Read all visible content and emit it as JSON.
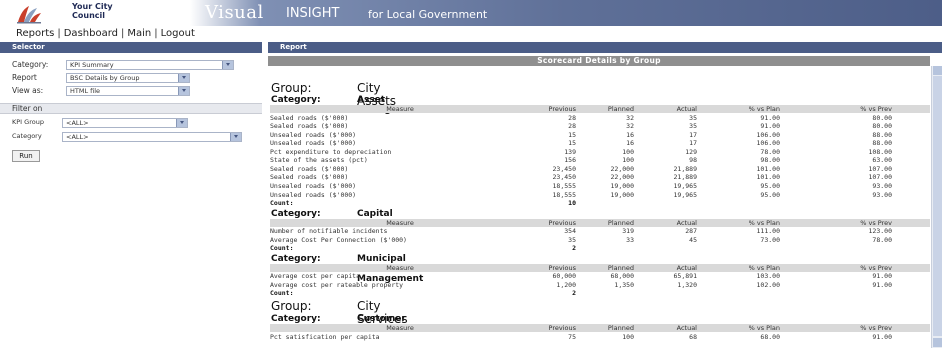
{
  "header": {
    "council_line1": "Your City",
    "council_line2": "Council",
    "brand_visual": "Visual",
    "brand_insight": "INSIGHT",
    "brand_sub": "for Local Government"
  },
  "nav": [
    "Reports",
    "Dashboard",
    "Main",
    "Logout"
  ],
  "sidebar": {
    "title": "Selector",
    "category_label": "Category:",
    "category_value": "KPI Summary",
    "report_label": "Report",
    "report_value": "BSC Details by Group",
    "viewas_label": "View as:",
    "viewas_value": "HTML file",
    "filter_title": "Filter on",
    "kpigroup_label": "KPI Group",
    "kpigroup_value": "<ALL>",
    "filtercat_label": "Category",
    "filtercat_value": "<ALL>",
    "run_label": "Run"
  },
  "report": {
    "title": "Report",
    "scorecard_title": "Scorecard Details by Group",
    "group_label": "Group:",
    "category_label": "Category:",
    "count_label": "Count:",
    "columns": [
      "Measure",
      "Previous",
      "Planned",
      "Actual",
      "% vs Plan",
      "% vs Prev"
    ],
    "groups": [
      {
        "name": "City Assets",
        "categories": [
          {
            "name": "Asset Management",
            "count": "10",
            "rows": [
              [
                "Sealed roads ($'000)",
                "28",
                "32",
                "35",
                "91.00",
                "80.00"
              ],
              [
                "Sealed roads ($'000)",
                "28",
                "32",
                "35",
                "91.00",
                "80.00"
              ],
              [
                "Unsealed roads ($'000)",
                "15",
                "16",
                "17",
                "106.00",
                "88.00"
              ],
              [
                "Unsealed roads ($'000)",
                "15",
                "16",
                "17",
                "106.00",
                "88.00"
              ],
              [
                "Pct expenditure to depreciation",
                "139",
                "100",
                "129",
                "78.00",
                "108.00"
              ],
              [
                "State of the assets (pct)",
                "156",
                "100",
                "98",
                "98.00",
                "63.00"
              ],
              [
                "Sealed roads ($'000)",
                "23,450",
                "22,000",
                "21,889",
                "101.00",
                "107.00"
              ],
              [
                "Sealed roads ($'000)",
                "23,450",
                "22,000",
                "21,889",
                "101.00",
                "107.00"
              ],
              [
                "Unsealed roads ($'000)",
                "18,555",
                "19,000",
                "19,965",
                "95.00",
                "93.00"
              ],
              [
                "Unsealed roads ($'000)",
                "18,555",
                "19,000",
                "19,965",
                "95.00",
                "93.00"
              ]
            ]
          },
          {
            "name": "Capital Works",
            "count": "2",
            "rows": [
              [
                "Number of notifiable incidents",
                "354",
                "319",
                "287",
                "111.00",
                "123.00"
              ],
              [
                "Average Cost Per Connection ($'000)",
                "35",
                "33",
                "45",
                "73.00",
                "78.00"
              ]
            ]
          },
          {
            "name": "Municipal Waste Management",
            "count": "2",
            "rows": [
              [
                "Average cost per capita",
                "60,000",
                "68,000",
                "65,891",
                "103.00",
                "91.00"
              ],
              [
                "Average cost per rateable property",
                "1,200",
                "1,350",
                "1,320",
                "102.00",
                "91.00"
              ]
            ]
          }
        ]
      },
      {
        "name": "City Services",
        "categories": [
          {
            "name": "Customer Service",
            "rows": [
              [
                "Pct satisfication per capita",
                "75",
                "100",
                "68",
                "68.00",
                "91.00"
              ]
            ]
          }
        ]
      }
    ]
  }
}
